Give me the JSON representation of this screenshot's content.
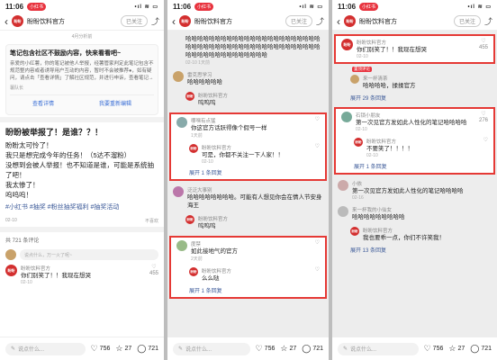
{
  "status": {
    "time": "11:06",
    "tag": "小红书",
    "signal": "•ıl ≋ ▭"
  },
  "account": {
    "name": "盼盼饮料官方",
    "follow": "已关注",
    "logo": "盼盼"
  },
  "p1": {
    "meta": "4月分析前",
    "notice_title": "笔记包含社区不鼓励内容，快来看看吧~",
    "notice_text": "亲爱的小红薯，你的笔记被他人举报，经薯管家判定此笔记包含不规范整内容或者诱导用户互动的内容，暂时不会被推荐●，如有疑问，请点击「查看详情」了解社区规范，并进行申诉，查看笔记→",
    "notice_author": "薯队长",
    "btn_detail": "查看详情",
    "btn_edit": "我要重新编辑",
    "title": "盼盼被举报了！是谁？？！",
    "lines": [
      "盼盼太可怜了！",
      "我只是想完成今年的任务！（5达不溜粉）",
      "没想到会被人举报！也不知道是谁，可能是系统抽了吧！",
      "我太惨了！",
      "呜呜呜！"
    ],
    "tags": "#小红书 #抽奖 #粉丝抽奖福利 #抽奖活动",
    "date": "02-10",
    "notfav": "不喜欢",
    "count": "共 721 条评论",
    "input": "说点什么，万一火了呢~",
    "c1_name": "盼盼饮料官方",
    "c1_text": "你们别笑了！！我现在想哭",
    "c1_date": "02-10",
    "c1_likes": "455"
  },
  "bar": {
    "say": "说点什么...",
    "likes": "756",
    "stars": "27",
    "comments": "721"
  },
  "p2": {
    "top1": "哈哈哈哈哈哈哈哈哈哈哈哈哈哈哈哈哈哈哈哈哈哈哈哈哈哈哈哈哈哈哈哈哈哈哈哈哈哈哈哈哈哈哈哈哈哈哈哈哈哈哈哈哈哈哈哈哈哈哈哈",
    "top1_date": "02-10 1天前",
    "c2_name": "雷克思学习",
    "c2_text": "哈哈哈哈哈哈",
    "c3_name": "盼盼饮料官方",
    "c3_text": "呜呜呜",
    "c4_name": "哪嘿有点猛",
    "c4_text": "你这官方话跃得像个假号一样",
    "c4_date": "1天前",
    "c5_name": "盼盼饮料官方",
    "c5_text": "可是，你都不关注一下人家！！",
    "c5_date": "02-10",
    "more1": "展开 1 条回复",
    "c6_name": "泛泛大事别",
    "c6_text": "哈哈哈哈哈哈哈哈。可能有人想见你会在情人节安身海王",
    "c7_name": "盼盼饮料官方",
    "c7_text": "呜呜呜",
    "c8_name": "度禁",
    "c8_text": "如此接地气的官方",
    "c8_date": "2天前",
    "c9_name": "盼盼饮料官方",
    "c9_text": "么么哒",
    "more2": "展开 1 条回复"
  },
  "p3": {
    "c1_name": "盼盼饮料官方",
    "c1_text": "你们别笑了！！我现在想哭",
    "c1_date": "02-10",
    "c1_likes": "455",
    "badge": "置顶评论",
    "c2_name": "来一杯清茶",
    "c2_text": "哈哈哈哈，揉揉官方",
    "more1": "展开 29 条回复",
    "c3_name": "石锁小朋友",
    "c3_text": "第一次见官方发如此人性化的笔记哈哈哈哈",
    "c3_date": "02-10",
    "c3_likes": "276",
    "c4_name": "盼盼饮料官方",
    "c4_text": "不要笑了！！！！",
    "c4_date": "02-10",
    "more2": "展开 1 条回复",
    "c5_name": "小依",
    "c5_text": "第一次见官方发如此人性化的笔记哈哈哈哈",
    "c5_date": "02-16",
    "c6_name": "来一杯我的小仙女",
    "c6_text": "哈哈哈哈哈哈哈哈哈",
    "c7_name": "盼盼饮料官方",
    "c7_text": "我也要乖一点，你们不许笑我！",
    "more3": "展开 13 条回复"
  }
}
